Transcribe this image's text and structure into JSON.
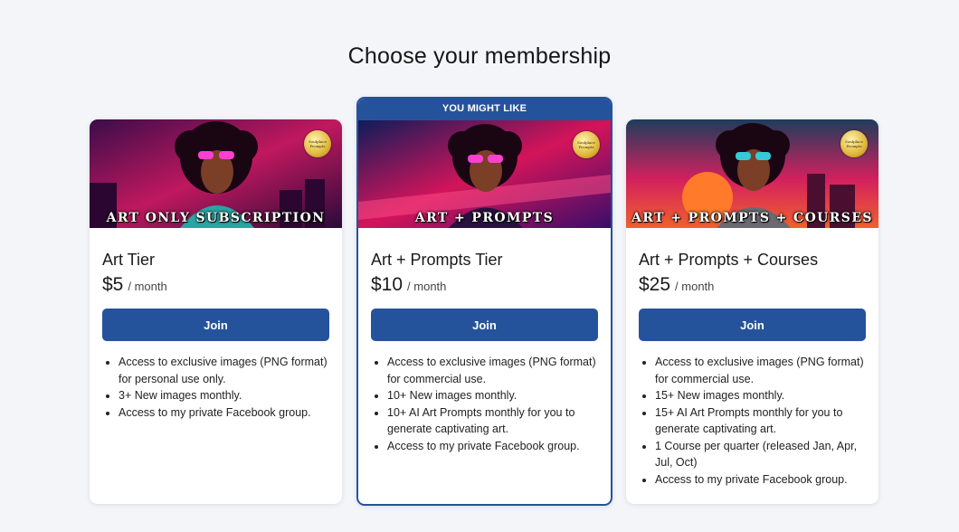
{
  "page": {
    "title": "Choose your membership"
  },
  "colors": {
    "accent": "#25539b",
    "background": "#f3f5f9"
  },
  "tiers": [
    {
      "banner_caption": "ART ONLY SUBSCRIPTION",
      "badge_text": "Soulplace Prompts",
      "name": "Art Tier",
      "price": "$5",
      "period": "/ month",
      "button": "Join",
      "features": [
        "Access to exclusive images (PNG format) for personal use only.",
        "3+ New images monthly.",
        "Access to my private Facebook group."
      ]
    },
    {
      "ribbon": "YOU MIGHT LIKE",
      "banner_caption": "ART + PROMPTS",
      "badge_text": "Soulplace Prompts",
      "name": "Art + Prompts Tier",
      "price": "$10",
      "period": "/ month",
      "button": "Join",
      "features": [
        "Access to exclusive images (PNG format) for commercial use.",
        "10+ New images monthly.",
        "10+ AI Art Prompts monthly for you to generate captivating art.",
        "Access to my private Facebook group."
      ]
    },
    {
      "banner_caption": "ART + PROMPTS + COURSES",
      "badge_text": "Soulplace Prompts",
      "name": "Art + Prompts + Courses",
      "price": "$25",
      "period": "/ month",
      "button": "Join",
      "features": [
        "Access to exclusive images (PNG format) for commercial use.",
        "15+ New images monthly.",
        "15+ AI Art Prompts monthly for you to generate captivating art.",
        "1 Course per quarter (released Jan, Apr, Jul, Oct)",
        "Access to my private Facebook group."
      ]
    }
  ]
}
